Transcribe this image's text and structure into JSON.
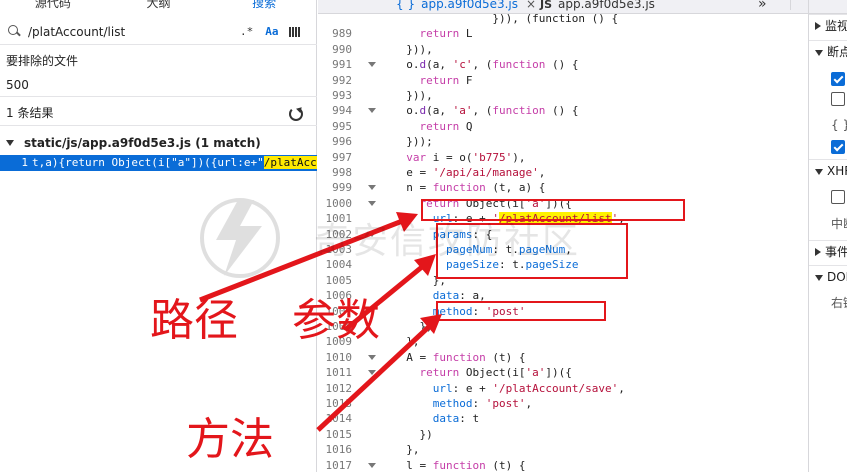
{
  "left_panel": {
    "tabs": [
      {
        "label": "源代码",
        "active": false
      },
      {
        "label": "大纲",
        "active": false
      },
      {
        "label": "搜索",
        "active": true
      }
    ],
    "search": {
      "value": "/platAccount/list",
      "placeholder": "",
      "regex_label": ".*",
      "case_label": "Aa"
    },
    "exclude_label": "要排除的文件",
    "exclude_value": "500",
    "results_count": "1 条结果",
    "file": "static/js/app.a9f0d5e3.js (1 match)",
    "match": {
      "line": "1",
      "text": "t,a){return Object(i[\"a\"])({url:e+\"",
      "highlight": "/platAcco"
    }
  },
  "code_panel": {
    "tabs": [
      {
        "icon": "{ }",
        "label": "app.a9f0d5e3.js",
        "active": true,
        "close": "×"
      },
      {
        "icon": "JS",
        "label": "app.a9f0d5e3.js",
        "active": false
      }
    ],
    "overflow": "»",
    "lines": [
      {
        "n": "",
        "fold": false,
        "parts": [
          [
            "",
            "               })), (function () {"
          ]
        ]
      },
      {
        "n": "989",
        "fold": false,
        "parts": [
          [
            "",
            "    "
          ],
          [
            "kw",
            "return"
          ],
          [
            "",
            " L"
          ]
        ]
      },
      {
        "n": "990",
        "fold": false,
        "parts": [
          [
            "",
            "  })),"
          ]
        ]
      },
      {
        "n": "991",
        "fold": true,
        "parts": [
          [
            "",
            "  o."
          ],
          [
            "fn",
            "d"
          ],
          [
            "",
            "(a, "
          ],
          [
            "str",
            "'c'"
          ],
          [
            "",
            ", ("
          ],
          [
            "kw",
            "function"
          ],
          [
            "",
            " () {"
          ]
        ]
      },
      {
        "n": "992",
        "fold": false,
        "parts": [
          [
            "",
            "    "
          ],
          [
            "kw",
            "return"
          ],
          [
            "",
            " F"
          ]
        ]
      },
      {
        "n": "993",
        "fold": false,
        "parts": [
          [
            "",
            "  })),"
          ]
        ]
      },
      {
        "n": "994",
        "fold": true,
        "parts": [
          [
            "",
            "  o."
          ],
          [
            "fn",
            "d"
          ],
          [
            "",
            "(a, "
          ],
          [
            "str",
            "'a'"
          ],
          [
            "",
            ", ("
          ],
          [
            "kw",
            "function"
          ],
          [
            "",
            " () {"
          ]
        ]
      },
      {
        "n": "995",
        "fold": false,
        "parts": [
          [
            "",
            "    "
          ],
          [
            "kw",
            "return"
          ],
          [
            "",
            " Q"
          ]
        ]
      },
      {
        "n": "996",
        "fold": false,
        "parts": [
          [
            "",
            "  }));"
          ]
        ]
      },
      {
        "n": "997",
        "fold": false,
        "parts": [
          [
            "",
            "  "
          ],
          [
            "kw",
            "var"
          ],
          [
            "",
            " i = o("
          ],
          [
            "str",
            "'b775'"
          ],
          [
            "",
            "),"
          ]
        ]
      },
      {
        "n": "998",
        "fold": false,
        "parts": [
          [
            "",
            "  e = "
          ],
          [
            "str",
            "'/api/ai/manage'"
          ],
          [
            "",
            ","
          ]
        ]
      },
      {
        "n": "999",
        "fold": true,
        "parts": [
          [
            "",
            "  n = "
          ],
          [
            "kw",
            "function"
          ],
          [
            "",
            " (t, a) {"
          ]
        ]
      },
      {
        "n": "1000",
        "fold": true,
        "parts": [
          [
            "",
            "    "
          ],
          [
            "kw",
            "return"
          ],
          [
            "",
            " Object(i["
          ],
          [
            "str",
            "'a'"
          ],
          [
            "",
            "])({"
          ]
        ]
      },
      {
        "n": "1001",
        "fold": false,
        "parts": [
          [
            "",
            "      "
          ],
          [
            "prop",
            "url"
          ],
          [
            "",
            ": e + "
          ],
          [
            "str",
            "'"
          ],
          [
            "strh",
            "/platAccount/list"
          ],
          [
            "str",
            "'"
          ],
          [
            "",
            ","
          ]
        ]
      },
      {
        "n": "1002",
        "fold": true,
        "parts": [
          [
            "",
            "      "
          ],
          [
            "prop",
            "params"
          ],
          [
            "",
            ": {"
          ]
        ]
      },
      {
        "n": "1003",
        "fold": false,
        "parts": [
          [
            "",
            "        "
          ],
          [
            "prop",
            "pageNum"
          ],
          [
            "",
            ": t."
          ],
          [
            "prop",
            "pageNum"
          ],
          [
            "",
            ","
          ]
        ]
      },
      {
        "n": "1004",
        "fold": false,
        "parts": [
          [
            "",
            "        "
          ],
          [
            "prop",
            "pageSize"
          ],
          [
            "",
            ": t."
          ],
          [
            "prop",
            "pageSize"
          ]
        ]
      },
      {
        "n": "1005",
        "fold": false,
        "parts": [
          [
            "",
            "      },"
          ]
        ]
      },
      {
        "n": "1006",
        "fold": false,
        "parts": [
          [
            "",
            "      "
          ],
          [
            "prop",
            "data"
          ],
          [
            "",
            ": a,"
          ]
        ]
      },
      {
        "n": "1007",
        "fold": false,
        "parts": [
          [
            "",
            "      "
          ],
          [
            "prop",
            "method"
          ],
          [
            "",
            ": "
          ],
          [
            "str",
            "'post'"
          ]
        ]
      },
      {
        "n": "1008",
        "fold": false,
        "parts": [
          [
            "",
            "    })"
          ]
        ]
      },
      {
        "n": "1009",
        "fold": false,
        "parts": [
          [
            "",
            "  },"
          ]
        ]
      },
      {
        "n": "1010",
        "fold": true,
        "parts": [
          [
            "",
            "  A = "
          ],
          [
            "kw",
            "function"
          ],
          [
            "",
            " (t) {"
          ]
        ]
      },
      {
        "n": "1011",
        "fold": true,
        "parts": [
          [
            "",
            "    "
          ],
          [
            "kw",
            "return"
          ],
          [
            "",
            " Object(i["
          ],
          [
            "str",
            "'a'"
          ],
          [
            "",
            "])({"
          ]
        ]
      },
      {
        "n": "1012",
        "fold": false,
        "parts": [
          [
            "",
            "      "
          ],
          [
            "prop",
            "url"
          ],
          [
            "",
            ": e + "
          ],
          [
            "str",
            "'/platAccount/save'"
          ],
          [
            "",
            ","
          ]
        ]
      },
      {
        "n": "1013",
        "fold": false,
        "parts": [
          [
            "",
            "      "
          ],
          [
            "prop",
            "method"
          ],
          [
            "",
            ": "
          ],
          [
            "str",
            "'post'"
          ],
          [
            "",
            ","
          ]
        ]
      },
      {
        "n": "1014",
        "fold": false,
        "parts": [
          [
            "",
            "      "
          ],
          [
            "prop",
            "data"
          ],
          [
            "",
            ": t"
          ]
        ]
      },
      {
        "n": "1015",
        "fold": false,
        "parts": [
          [
            "",
            "    })"
          ]
        ]
      },
      {
        "n": "1016",
        "fold": false,
        "parts": [
          [
            "",
            "  },"
          ]
        ]
      },
      {
        "n": "1017",
        "fold": true,
        "parts": [
          [
            "",
            "  l = "
          ],
          [
            "kw",
            "function"
          ],
          [
            "",
            " (t) {"
          ]
        ]
      }
    ]
  },
  "right_panel": {
    "rows": [
      {
        "type": "section",
        "label": "监视",
        "open": false
      },
      {
        "type": "section",
        "label": "断点",
        "open": true
      },
      {
        "type": "checkbox",
        "checked": true
      },
      {
        "type": "checkbox",
        "checked": false
      },
      {
        "type": "text",
        "label": "{ }"
      },
      {
        "type": "checkbox",
        "checked": true
      },
      {
        "type": "section",
        "label": "XHR",
        "open": true
      },
      {
        "type": "checkbox",
        "checked": false
      },
      {
        "type": "text",
        "label": "中断"
      },
      {
        "type": "section",
        "label": "事件",
        "open": false
      },
      {
        "type": "section",
        "label": "DOM",
        "open": true
      },
      {
        "type": "text",
        "label": "右键"
      }
    ]
  },
  "annotations": {
    "path_label": "路径",
    "params_label": "参数",
    "method_label": "方法",
    "annotation_color": "#e3161b",
    "watermark": "奇安信攻防社区"
  }
}
